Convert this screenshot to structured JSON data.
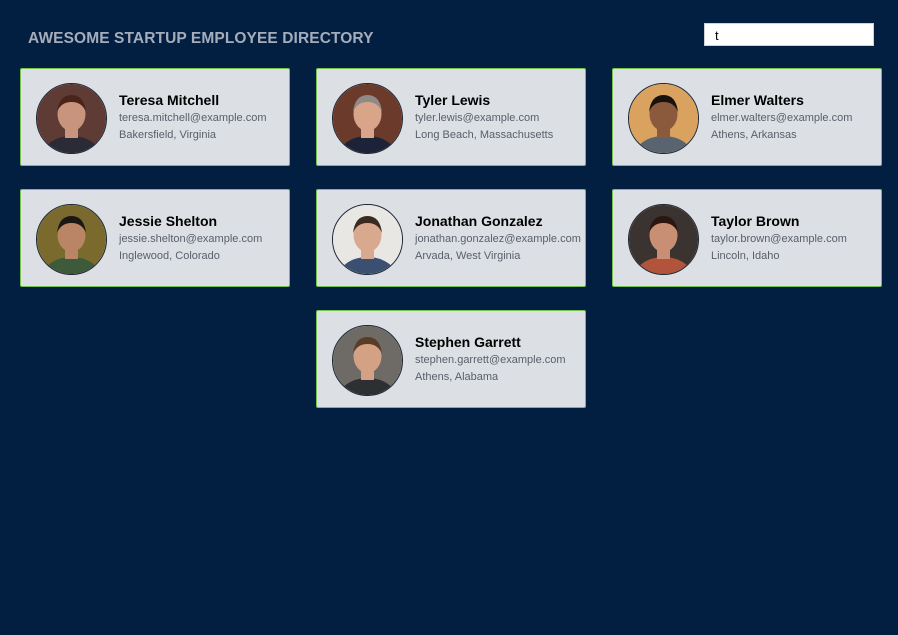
{
  "header": {
    "title": "AWESOME STARTUP EMPLOYEE DIRECTORY",
    "search_value": "t",
    "search_placeholder": ""
  },
  "employees": [
    {
      "name": "Teresa Mitchell",
      "email": "teresa.mitchell@example.com",
      "location": "Bakersfield, Virginia",
      "skin": "#c9947e",
      "hair": "#4a2418",
      "bg": "#5e3b34",
      "shirt": "#2b2b36"
    },
    {
      "name": "Tyler Lewis",
      "email": "tyler.lewis@example.com",
      "location": "Long Beach, Massachusetts",
      "skin": "#d9a58a",
      "hair": "#8e8a86",
      "bg": "#6b3a2a",
      "shirt": "#1c2238"
    },
    {
      "name": "Elmer Walters",
      "email": "elmer.walters@example.com",
      "location": "Athens, Arkansas",
      "skin": "#8b5a3c",
      "hair": "#1a120e",
      "bg": "#d9a25e",
      "shirt": "#5a6470"
    },
    {
      "name": "Jessie Shelton",
      "email": "jessie.shelton@example.com",
      "location": "Inglewood, Colorado",
      "skin": "#b98564",
      "hair": "#1b1713",
      "bg": "#7a6a2e",
      "shirt": "#3d5a3a"
    },
    {
      "name": "Jonathan Gonzalez",
      "email": "jonathan.gonzalez@example.com",
      "location": "Arvada, West Virginia",
      "skin": "#d8a98f",
      "hair": "#3a2a20",
      "bg": "#e9e7e4",
      "shirt": "#3b4f73"
    },
    {
      "name": "Taylor Brown",
      "email": "taylor.brown@example.com",
      "location": "Lincoln, Idaho",
      "skin": "#c98f75",
      "hair": "#2b1710",
      "bg": "#3a3330",
      "shirt": "#b2533b"
    },
    {
      "name": "Stephen Garrett",
      "email": "stephen.garrett@example.com",
      "location": "Athens, Alabama",
      "skin": "#d3a184",
      "hair": "#5a3b26",
      "bg": "#6e6a66",
      "shirt": "#2e2f33"
    }
  ]
}
